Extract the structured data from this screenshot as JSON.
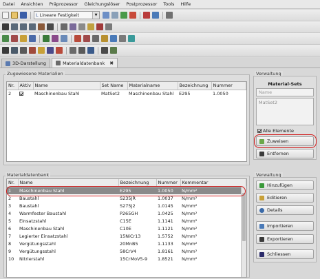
{
  "menu": [
    "Datei",
    "Ansichten",
    "Präprozessor",
    "Gleichungslöser",
    "Postprozessor",
    "Tools",
    "Hilfe"
  ],
  "toolbar": {
    "analysis_type": "Lineare Festigkeit"
  },
  "tabs": [
    {
      "label": "3D-Darstellung",
      "active": false
    },
    {
      "label": "Materialdatenbank",
      "active": true
    }
  ],
  "assigned": {
    "title": "Zugewiesene Materialien",
    "columns": [
      "Nr.",
      "Aktiv",
      "Name",
      "Set Name",
      "Materialname",
      "Bezeichnung",
      "Nummer"
    ],
    "rows": [
      {
        "nr": "2",
        "aktiv": true,
        "name": "Maschinenbau Stahl",
        "set": "MatSet2",
        "material": "Maschinenbau Stahl",
        "bez": "E295",
        "num": "1.0050"
      }
    ]
  },
  "verwaltung_top": {
    "title": "Verwaltung",
    "sets_title": "Material-Sets",
    "name_placeholder": "Name",
    "set_item": "MatSet2",
    "all_elements": "Alle Elemente",
    "assign": "Zuweisen",
    "remove": "Entfernen"
  },
  "database": {
    "title": "Materialdatenbank",
    "columns": [
      "Nr.",
      "Name",
      "Bezeichnung",
      "Nummer",
      "Kommentar"
    ],
    "rows": [
      {
        "nr": "1",
        "name": "Maschinenbau Stahl",
        "bez": "E295",
        "num": "1.0050",
        "kom": "N/mm²"
      },
      {
        "nr": "2",
        "name": "Baustahl",
        "bez": "S235JR",
        "num": "1.0037",
        "kom": "N/mm²"
      },
      {
        "nr": "3",
        "name": "Baustahl",
        "bez": "S275J2",
        "num": "1.0145",
        "kom": "N/mm²"
      },
      {
        "nr": "4",
        "name": "Warmfester Baustahl",
        "bez": "P265GH",
        "num": "1.0425",
        "kom": "N/mm²"
      },
      {
        "nr": "5",
        "name": "Einsatzstahl",
        "bez": "C15E",
        "num": "1.1141",
        "kom": "N/mm²"
      },
      {
        "nr": "6",
        "name": "Maschinenbau Stahl",
        "bez": "C10E",
        "num": "1.1121",
        "kom": "N/mm²"
      },
      {
        "nr": "7",
        "name": "Legierter Einsatzstahl",
        "bez": "15NiCr13",
        "num": "1.5752",
        "kom": "N/mm²"
      },
      {
        "nr": "8",
        "name": "Vergütungsstahl",
        "bez": "20MnB5",
        "num": "1.1133",
        "kom": "N/mm²"
      },
      {
        "nr": "9",
        "name": "Vergütungsstahl",
        "bez": "58CrV4",
        "num": "1.8161",
        "kom": "N/mm²"
      },
      {
        "nr": "10",
        "name": "Nitrierstahl",
        "bez": "15CrMoV5-9",
        "num": "1.8521",
        "kom": "N/mm²"
      }
    ]
  },
  "verwaltung_bottom": {
    "title": "Verwaltung",
    "buttons": [
      "Hinzufügen",
      "Editieren",
      "Details",
      "Importieren",
      "Exportieren",
      "Schliessen"
    ]
  }
}
